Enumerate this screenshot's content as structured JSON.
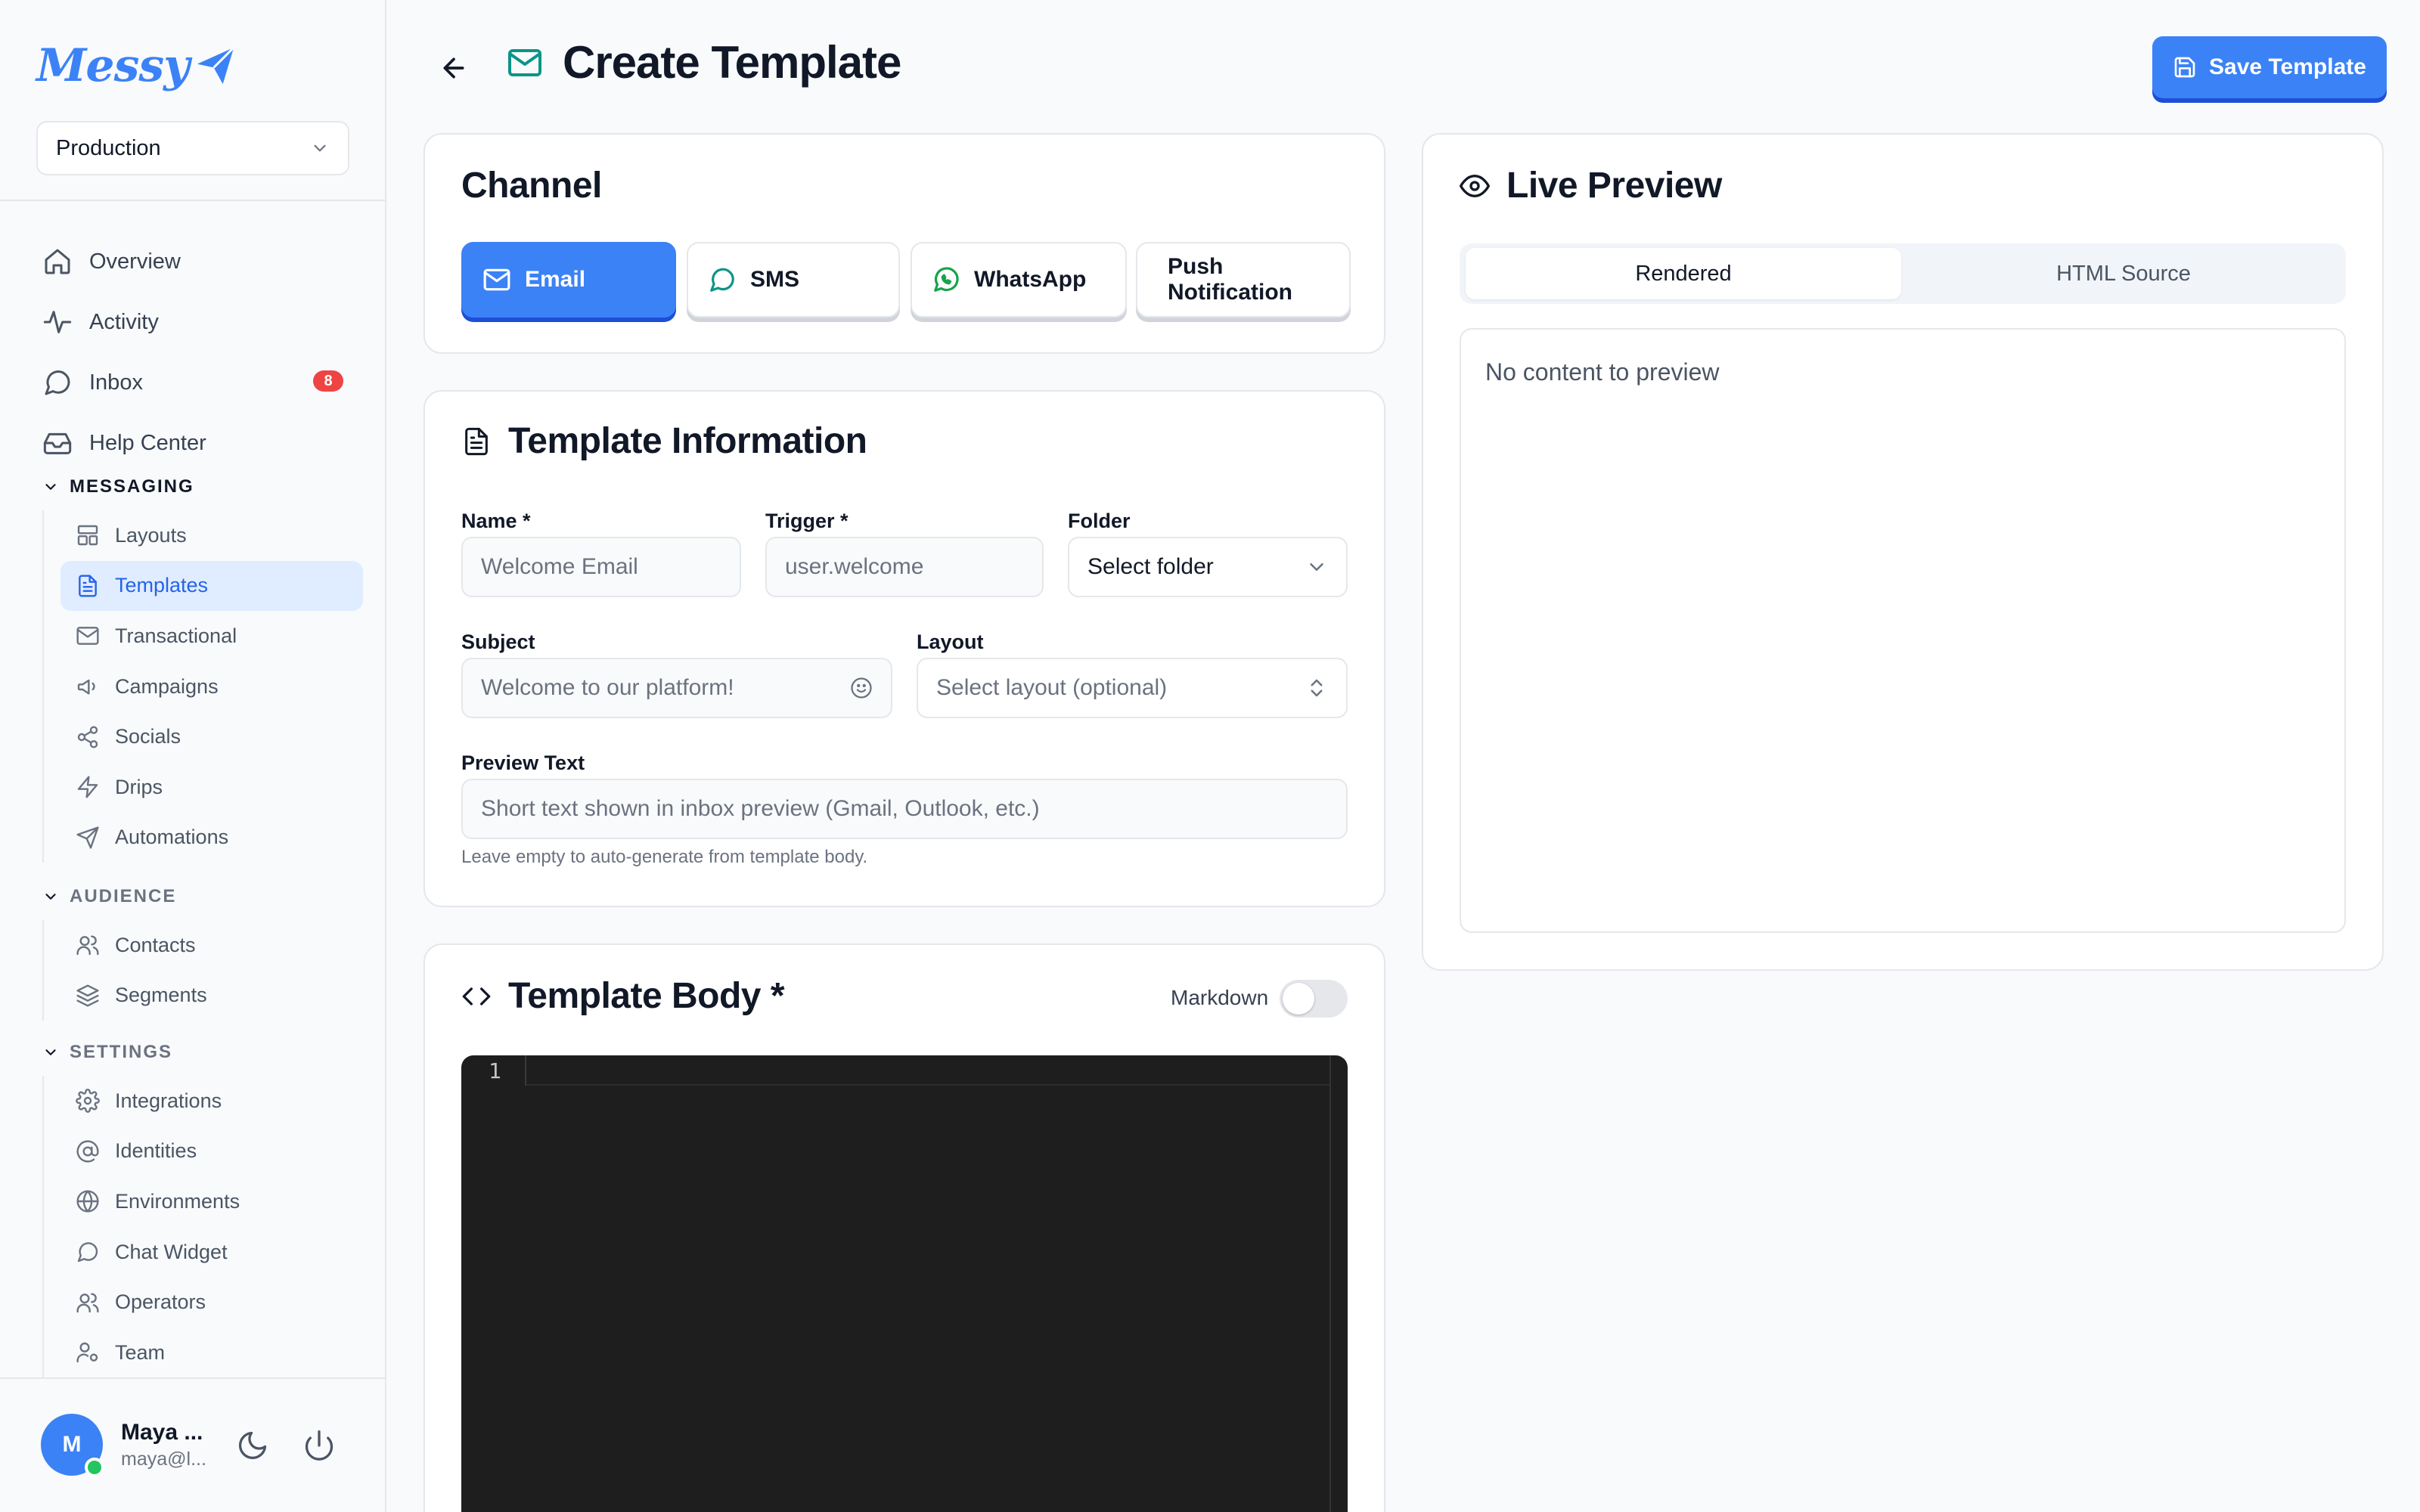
{
  "app": {
    "logo_text": "Messy",
    "brand_color": "#3b82f6",
    "environment": "Production"
  },
  "nav": {
    "main": [
      {
        "label": "Overview",
        "icon": "home-icon"
      },
      {
        "label": "Activity",
        "icon": "activity-icon"
      },
      {
        "label": "Inbox",
        "icon": "message-circle-icon",
        "badge": "8"
      },
      {
        "label": "Help Center",
        "icon": "inbox-tray-icon"
      }
    ],
    "sections": [
      {
        "title": "MESSAGING",
        "items": [
          {
            "label": "Layouts",
            "icon": "layout-icon"
          },
          {
            "label": "Templates",
            "icon": "file-text-icon",
            "active": true
          },
          {
            "label": "Transactional",
            "icon": "mail-icon"
          },
          {
            "label": "Campaigns",
            "icon": "megaphone-icon"
          },
          {
            "label": "Socials",
            "icon": "share-icon"
          },
          {
            "label": "Drips",
            "icon": "zap-icon"
          },
          {
            "label": "Automations",
            "icon": "send-icon"
          }
        ]
      },
      {
        "title": "AUDIENCE",
        "items": [
          {
            "label": "Contacts",
            "icon": "users-icon"
          },
          {
            "label": "Segments",
            "icon": "layers-icon"
          }
        ]
      },
      {
        "title": "SETTINGS",
        "items": [
          {
            "label": "Integrations",
            "icon": "gear-icon"
          },
          {
            "label": "Identities",
            "icon": "at-sign-icon"
          },
          {
            "label": "Environments",
            "icon": "globe-icon"
          },
          {
            "label": "Chat Widget",
            "icon": "message-circle-icon"
          },
          {
            "label": "Operators",
            "icon": "users-icon"
          },
          {
            "label": "Team",
            "icon": "user-cog-icon"
          }
        ]
      }
    ]
  },
  "user": {
    "initial": "M",
    "name": "Maya ...",
    "email": "maya@l..."
  },
  "header": {
    "title": "Create Template",
    "save_label": "Save Template"
  },
  "channel": {
    "title": "Channel",
    "options": [
      {
        "label": "Email",
        "icon": "mail-icon",
        "active": true
      },
      {
        "label": "SMS",
        "icon": "message-circle-icon"
      },
      {
        "label": "WhatsApp",
        "icon": "whatsapp-icon",
        "icon_color": "#16a34a"
      },
      {
        "label": "Push Notification"
      }
    ]
  },
  "template_info": {
    "title": "Template Information",
    "name_label": "Name *",
    "name_placeholder": "Welcome Email",
    "trigger_label": "Trigger *",
    "trigger_placeholder": "user.welcome",
    "folder_label": "Folder",
    "folder_value": "Select folder",
    "subject_label": "Subject",
    "subject_placeholder": "Welcome to our platform!",
    "layout_label": "Layout",
    "layout_value": "Select layout (optional)",
    "preview_label": "Preview Text",
    "preview_placeholder": "Short text shown in inbox preview (Gmail, Outlook, etc.)",
    "preview_help": "Leave empty to auto-generate from template body."
  },
  "body": {
    "title": "Template Body *",
    "markdown_label": "Markdown",
    "markdown_enabled": false,
    "line_number": "1"
  },
  "preview": {
    "title": "Live Preview",
    "tabs": [
      "Rendered",
      "HTML Source"
    ],
    "active_tab": "Rendered",
    "empty_text": "No content to preview"
  }
}
